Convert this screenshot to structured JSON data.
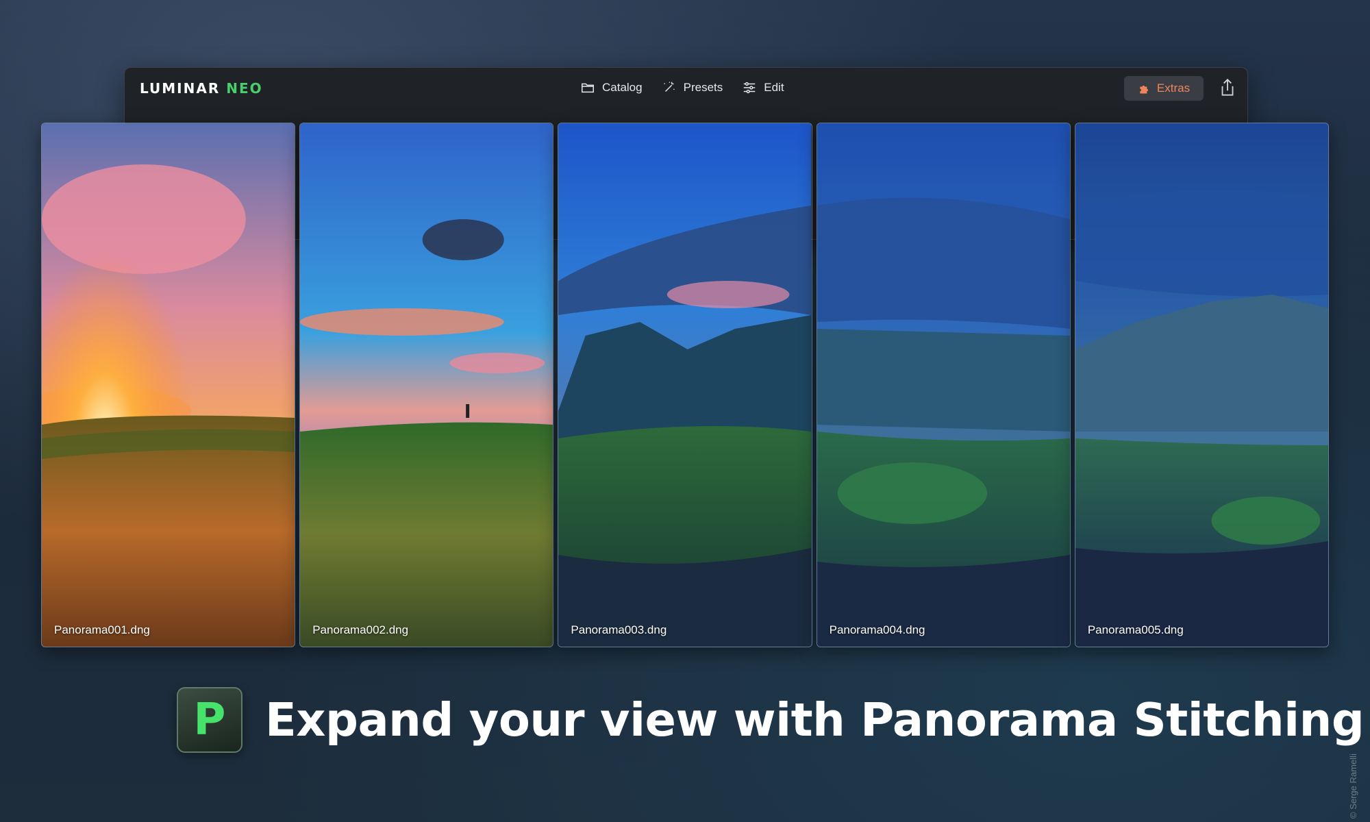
{
  "app": {
    "logo_main": "LUMINAR",
    "logo_accent": "NEO"
  },
  "nav": [
    {
      "label": "Catalog",
      "icon": "folder-icon"
    },
    {
      "label": "Presets",
      "icon": "magic-wand-icon"
    },
    {
      "label": "Edit",
      "icon": "sliders-icon"
    }
  ],
  "extras": {
    "label": "Extras",
    "icon": "puzzle-icon",
    "color": "#f0845a"
  },
  "share": {
    "icon": "share-icon"
  },
  "panels": [
    {
      "filename": "Panorama001.dng"
    },
    {
      "filename": "Panorama002.dng"
    },
    {
      "filename": "Panorama003.dng"
    },
    {
      "filename": "Panorama004.dng"
    },
    {
      "filename": "Panorama005.dng"
    }
  ],
  "headline": {
    "badge_letter": "P",
    "text": "Expand your view with Panorama Stitching"
  },
  "credit": "© Serge Ramelli",
  "colors": {
    "accent_green": "#4ad06b",
    "extras_orange": "#f0845a"
  }
}
